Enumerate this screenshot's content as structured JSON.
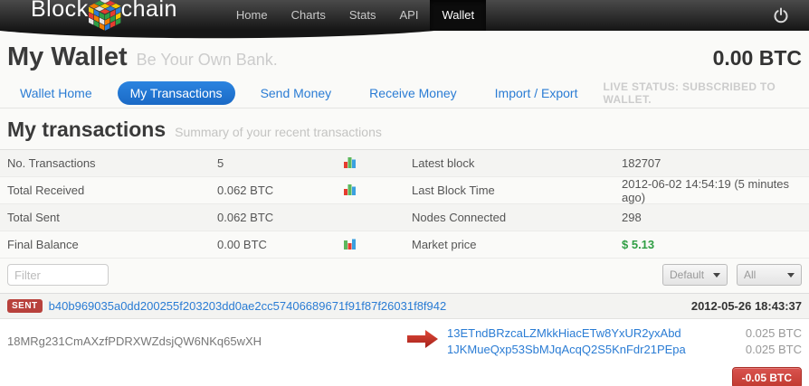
{
  "navbar": {
    "logo_part1": "Block",
    "logo_part2": "chain",
    "items": [
      {
        "label": "Home",
        "active": false
      },
      {
        "label": "Charts",
        "active": false
      },
      {
        "label": "Stats",
        "active": false
      },
      {
        "label": "API",
        "active": false
      },
      {
        "label": "Wallet",
        "active": true
      }
    ]
  },
  "header": {
    "title": "My Wallet",
    "tagline": "Be Your Own Bank.",
    "balance": "0.00 BTC"
  },
  "tabs": {
    "items": [
      {
        "label": "Wallet Home",
        "active": false
      },
      {
        "label": "My Transactions",
        "active": true
      },
      {
        "label": "Send Money",
        "active": false
      },
      {
        "label": "Receive Money",
        "active": false
      },
      {
        "label": "Import / Export",
        "active": false
      }
    ],
    "live_status": "LIVE STATUS: SUBSCRIBED TO WALLET."
  },
  "section": {
    "title": "My transactions",
    "subtitle": "Summary of your recent transactions"
  },
  "stats_left": {
    "rows": [
      {
        "label": "No. Transactions",
        "value": "5"
      },
      {
        "label": "Total Received",
        "value": "0.062 BTC"
      },
      {
        "label": "Total Sent",
        "value": "0.062 BTC"
      },
      {
        "label": "Final Balance",
        "value": "0.00 BTC"
      }
    ]
  },
  "stats_right": {
    "rows": [
      {
        "label": "Latest block",
        "value": "182707"
      },
      {
        "label": "Last Block Time",
        "value": "2012-06-02 14:54:19 (5 minutes ago)"
      },
      {
        "label": "Nodes Connected",
        "value": "298"
      },
      {
        "label": "Market price",
        "value": "$ 5.13"
      }
    ]
  },
  "filter": {
    "placeholder": "Filter"
  },
  "dropdowns": [
    {
      "value": "Default"
    },
    {
      "value": "All"
    }
  ],
  "transaction": {
    "badge": "SENT",
    "hash": "b40b969035a0dd200255f203203dd0ae2cc57406689671f91f87f26031f8f942",
    "date": "2012-05-26 18:43:37",
    "from_address": "18MRg231CmAXzfPDRXWZdsjQW6NKq65wXH",
    "outputs": [
      {
        "address": "13ETndBRzcaLZMkkHiacETw8YxUR2yxAbd",
        "amount": "0.025 BTC"
      },
      {
        "address": "1JKMueQxp53SbMJqAcqQ2S5KnFdr21PEpa",
        "amount": "0.025 BTC"
      }
    ],
    "total": "-0.05 BTC"
  },
  "colors": {
    "accent_blue": "#2a7cd4",
    "badge_red": "#b8413c",
    "total_red": "#c0392f",
    "price_green": "#2f9e44"
  }
}
